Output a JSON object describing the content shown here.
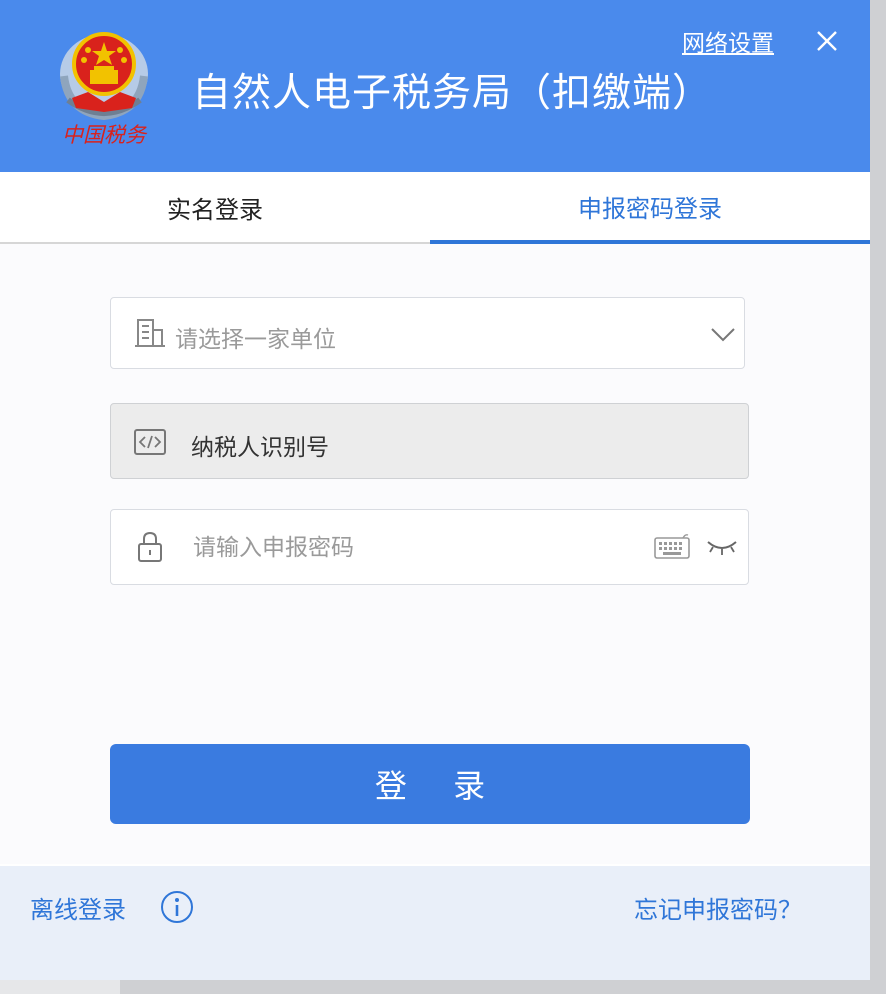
{
  "header": {
    "title": "自然人电子税务局（扣缴端）",
    "network_settings": "网络设置",
    "emblem_text": "中国税务",
    "colors": {
      "header_bg": "#4a8aec",
      "accent": "#2f76d8"
    }
  },
  "tabs": [
    {
      "label": "实名登录",
      "active": false
    },
    {
      "label": "申报密码登录",
      "active": true
    }
  ],
  "form": {
    "unit_select": {
      "placeholder": "请选择一家单位",
      "icon": "building-icon"
    },
    "taxpayer_id": {
      "label": "纳税人识别号",
      "icon": "code-icon"
    },
    "password": {
      "placeholder": "请输入申报密码",
      "icon": "lock-icon"
    }
  },
  "login_button": "登 录",
  "footer": {
    "offline_login": "离线登录",
    "forgot_password": "忘记申报密码？"
  }
}
